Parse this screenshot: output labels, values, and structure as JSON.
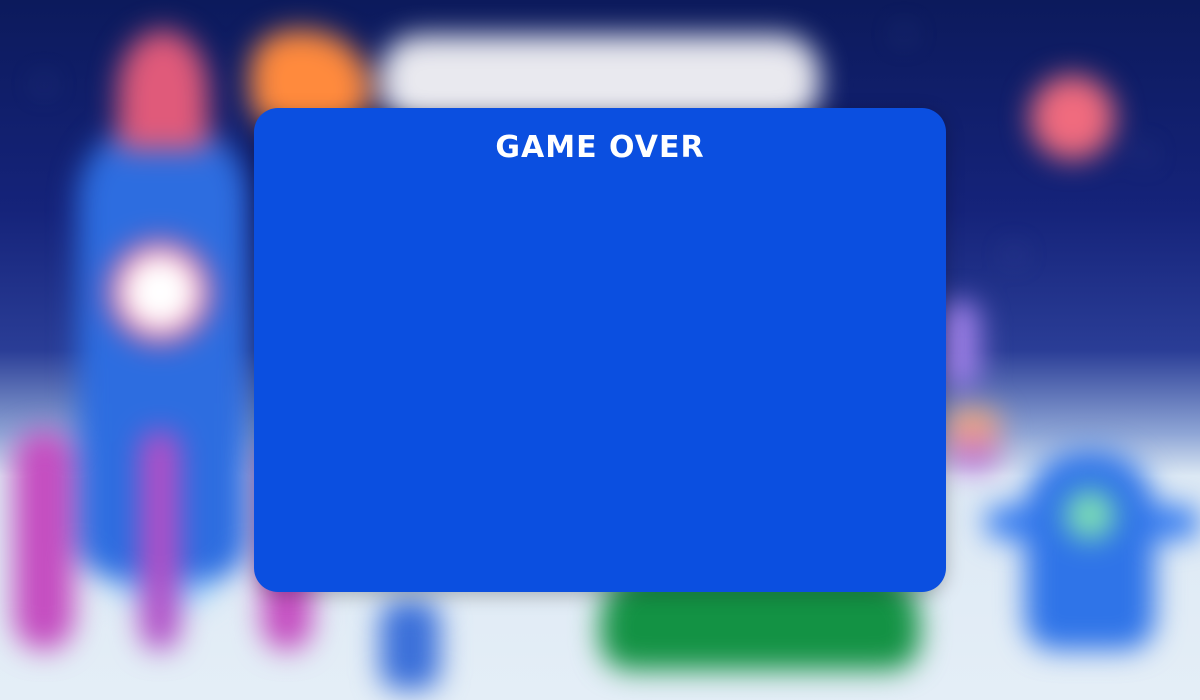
{
  "dialog": {
    "title": "GAME OVER"
  },
  "colors": {
    "panel": "#0b4fe0",
    "title_text": "#ffffff",
    "sky_top": "#0c1a5c",
    "ground": "#e4eef7"
  },
  "background": {
    "elements": [
      "rocket",
      "planet",
      "cloud",
      "red-moon",
      "alien",
      "green-shrub",
      "stars"
    ]
  }
}
